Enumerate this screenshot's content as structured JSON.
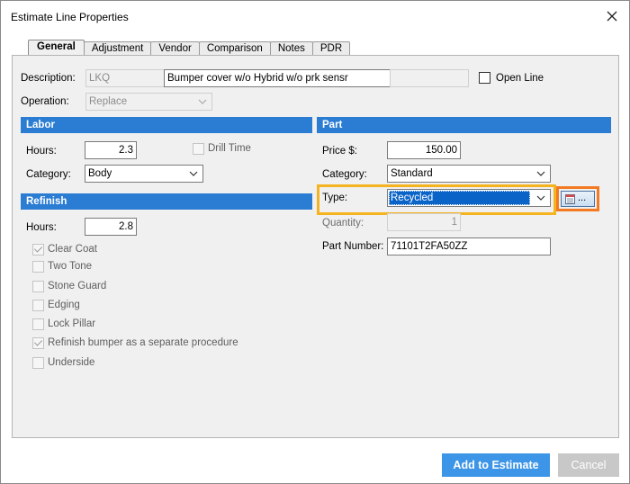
{
  "window": {
    "title": "Estimate Line Properties"
  },
  "tabs": [
    {
      "label": "General",
      "active": true
    },
    {
      "label": "Adjustment",
      "active": false
    },
    {
      "label": "Vendor",
      "active": false
    },
    {
      "label": "Comparison",
      "active": false
    },
    {
      "label": "Notes",
      "active": false
    },
    {
      "label": "PDR",
      "active": false
    }
  ],
  "general": {
    "description_label": "Description:",
    "description_code": "LKQ",
    "description_value": "Bumper cover w/o Hybrid w/o prk sensr",
    "open_line_label": "Open Line",
    "open_line_checked": false,
    "operation_label": "Operation:",
    "operation_value": "Replace"
  },
  "labor": {
    "header": "Labor",
    "hours_label": "Hours:",
    "hours_value": "2.3",
    "drill_time_label": "Drill Time",
    "drill_time_checked": false,
    "category_label": "Category:",
    "category_value": "Body"
  },
  "refinish": {
    "header": "Refinish",
    "hours_label": "Hours:",
    "hours_value": "2.8",
    "options": [
      {
        "label": "Clear Coat",
        "checked": true
      },
      {
        "label": "Two Tone",
        "checked": false
      },
      {
        "label": "Stone Guard",
        "checked": false
      },
      {
        "label": "Edging",
        "checked": false
      },
      {
        "label": "Lock Pillar",
        "checked": false
      },
      {
        "label": "Refinish bumper as a separate procedure",
        "checked": true
      },
      {
        "label": "Underside",
        "checked": false
      }
    ]
  },
  "part": {
    "header": "Part",
    "price_label": "Price $:",
    "price_value": "150.00",
    "category_label": "Category:",
    "category_value": "Standard",
    "type_label": "Type:",
    "type_value": "Recycled",
    "lookup_button_label": "...",
    "quantity_label": "Quantity:",
    "quantity_value": "1",
    "part_number_label": "Part Number:",
    "part_number_value": "71101T2FA50ZZ"
  },
  "footer": {
    "add_label": "Add to Estimate",
    "cancel_label": "Cancel"
  },
  "colors": {
    "section_header": "#2b7cd3",
    "primary_button": "#3c95e7",
    "highlight_type": "#f5b41f",
    "highlight_lookup": "#f37a22"
  },
  "icons": {
    "close": "close-icon",
    "dropdown": "chevron-down-icon",
    "lookup": "list-icon"
  }
}
